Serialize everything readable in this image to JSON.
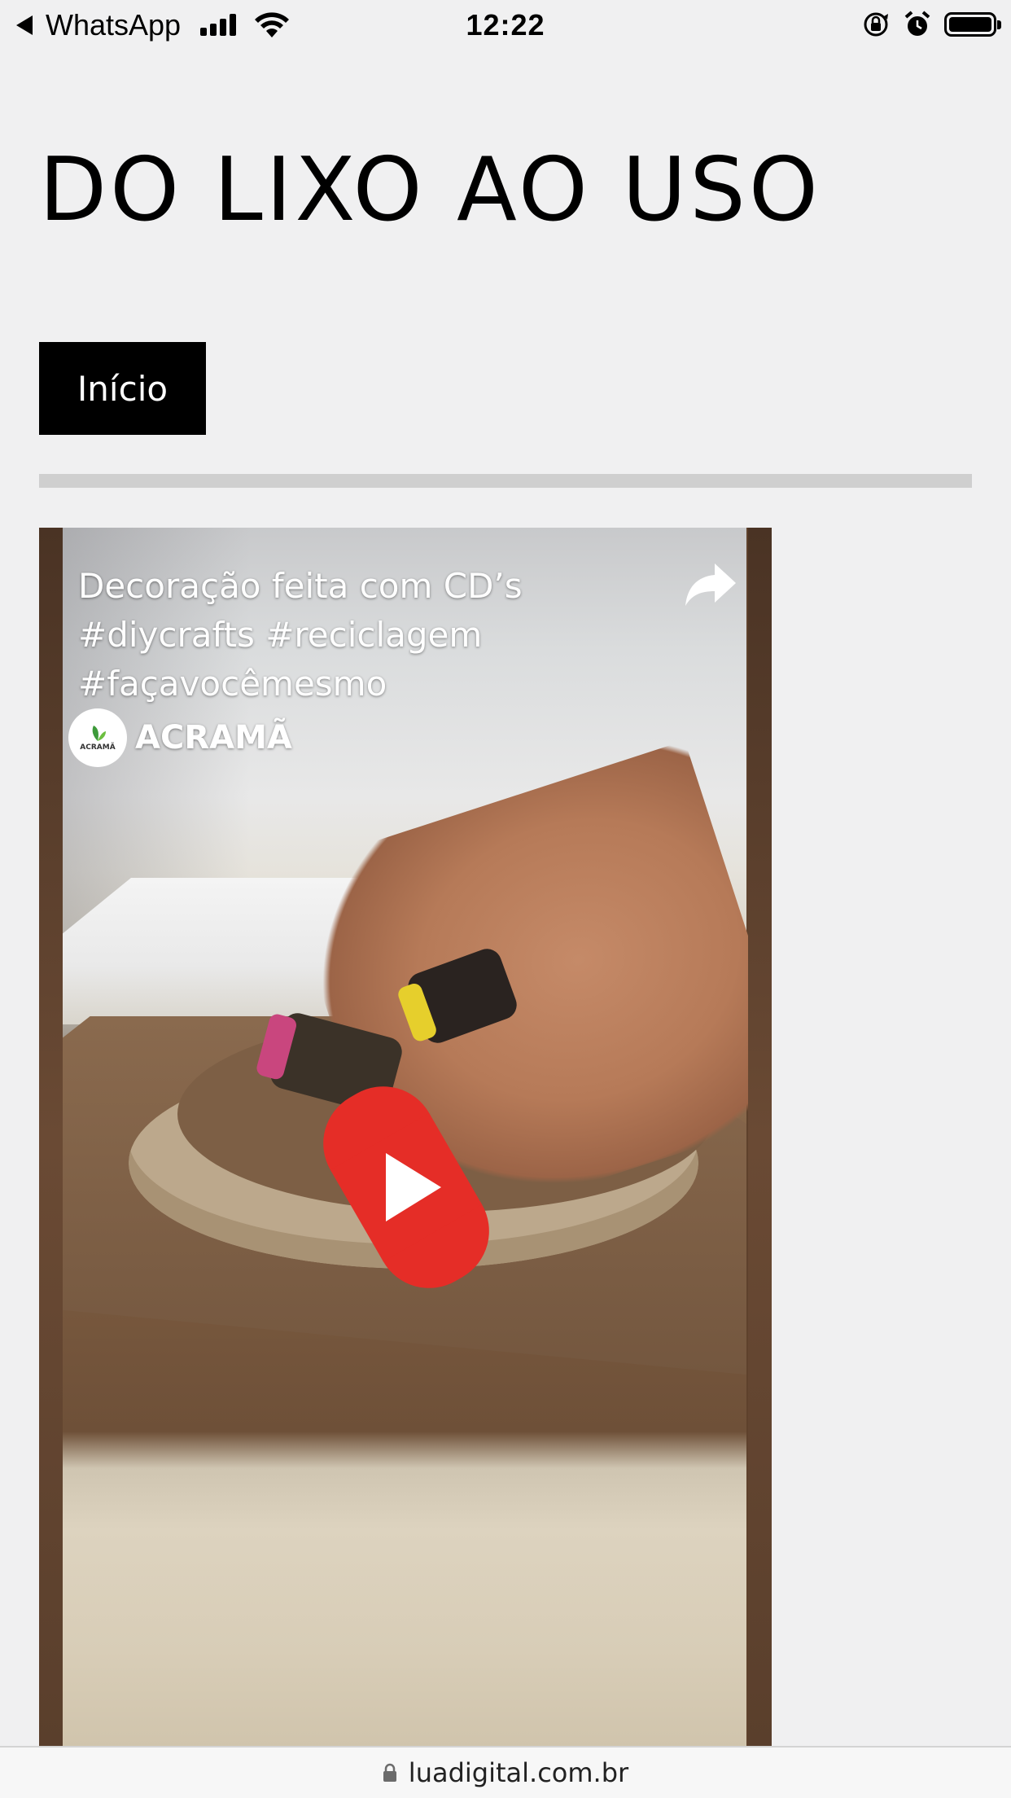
{
  "status_bar": {
    "back_app": "WhatsApp",
    "time": "12:22",
    "icons": [
      "back-triangle-icon",
      "signal-icon",
      "wifi-icon",
      "orientation-lock-icon",
      "alarm-icon",
      "battery-icon"
    ]
  },
  "site": {
    "title": "DO LIXO AO USO",
    "nav_button": "Início"
  },
  "video": {
    "title": "Decoração feita com CD’s\n#diycrafts #reciclagem\n#façavocêmesmo",
    "channel_name": "ACRAMÃ",
    "channel_avatar_text": "ACRAMÃ",
    "icons": [
      "share-icon",
      "youtube-shorts-play-icon"
    ],
    "play_color": "#e52d27"
  },
  "url_bar": {
    "url": "luadigital.com.br",
    "icon": "lock-icon"
  }
}
